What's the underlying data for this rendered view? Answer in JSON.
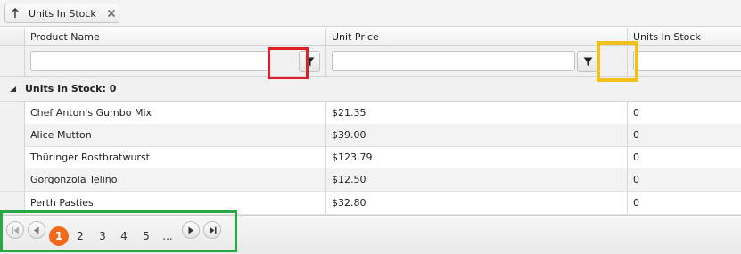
{
  "group_panel": {
    "chip_label": "Units In Stock",
    "sort_icon": "arrow-up-icon",
    "remove_icon": "close-icon"
  },
  "columns": {
    "product_name": "Product Name",
    "unit_price": "Unit Price",
    "units_in_stock": "Units In Stock"
  },
  "filters": {
    "product_name_value": "",
    "unit_price_value": "",
    "units_in_stock_value": "",
    "filter_icon": "funnel-icon"
  },
  "group": {
    "label": "Units In Stock: 0",
    "toggle_icon": "collapse-triangle-icon"
  },
  "rows": [
    {
      "product": "Chef Anton's Gumbo Mix",
      "price": "$21.35",
      "stock": "0"
    },
    {
      "product": "Alice Mutton",
      "price": "$39.00",
      "stock": "0"
    },
    {
      "product": "Thüringer Rostbratwurst",
      "price": "$123.79",
      "stock": "0"
    },
    {
      "product": "Gorgonzola Telino",
      "price": "$12.50",
      "stock": "0"
    },
    {
      "product": "Perth Pasties",
      "price": "$32.80",
      "stock": "0"
    }
  ],
  "pager": {
    "pages": [
      "1",
      "2",
      "3",
      "4",
      "5"
    ],
    "ellipsis": "...",
    "current_page": "1"
  },
  "colors": {
    "current_page": "#f06a1e",
    "highlight_red": "#e01e25",
    "highlight_yellow": "#f2c01c",
    "highlight_green": "#27a845"
  }
}
